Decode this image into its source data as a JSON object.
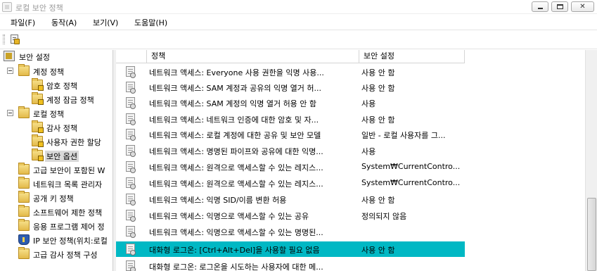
{
  "window": {
    "title": "로컬 보안 정책",
    "close_glyph": "✕"
  },
  "menu": [
    {
      "label": "파일(F)"
    },
    {
      "label": "동작(A)"
    },
    {
      "label": "보기(V)"
    },
    {
      "label": "도움말(H)"
    }
  ],
  "tree": {
    "root": "보안 설정",
    "account_policy": "계정 정책",
    "password_policy": "암호 정책",
    "account_lockout_policy": "계정 잠금 정책",
    "local_policy": "로컬 정책",
    "audit_policy": "감사 정책",
    "user_rights": "사용자 권한 할당",
    "security_options": "보안 옵션",
    "advanced_firewall": "고급 보안이 포함된 W",
    "network_list": "네트워크 목록 관리자",
    "public_key": "공개 키 정책",
    "software_restriction": "소프트웨어 제한 정책",
    "app_control": "응용 프로그램 제어 정",
    "ip_security": "IP 보안 정책(위치:로컬",
    "advanced_audit": "고급 감사 정책 구성"
  },
  "columns": {
    "policy": "정책",
    "security_setting": "보안 설정"
  },
  "rows": [
    {
      "policy": "네트워크 액세스: Everyone 사용 권한을 익명 사용...",
      "setting": "사용 안 함"
    },
    {
      "policy": "네트워크 액세스: SAM 계정과 공유의 익명 열거 허...",
      "setting": "사용 안 함"
    },
    {
      "policy": "네트워크 액세스: SAM 계정의 익명 열거 허용 안 함",
      "setting": "사용"
    },
    {
      "policy": "네트워크 액세스: 네트워크 인증에 대한 암호 및 자...",
      "setting": "사용 안 함"
    },
    {
      "policy": "네트워크 액세스: 로컬 계정에 대한 공유 및 보안 모델",
      "setting": "일반 - 로컬 사용자를 그..."
    },
    {
      "policy": "네트워크 액세스: 명명된 파이프와 공유에 대한 익명...",
      "setting": "사용"
    },
    {
      "policy": "네트워크 액세스: 원격으로 액세스할 수 있는 레지스...",
      "setting": "System₩CurrentContro..."
    },
    {
      "policy": "네트워크 액세스: 원격으로 액세스할 수 있는 레지스...",
      "setting": "System₩CurrentContro..."
    },
    {
      "policy": "네트워크 액세스: 익명 SID/이름 변환 허용",
      "setting": "사용 안 함"
    },
    {
      "policy": "네트워크 액세스: 익명으로 액세스할 수 있는 공유",
      "setting": "정의되지 않음"
    },
    {
      "policy": "네트워크 액세스: 익명으로 액세스할 수 있는 명명된...",
      "setting": ""
    },
    {
      "policy": "대화형 로그온: [Ctrl+Alt+Del]을 사용할 필요 없음",
      "setting": "사용 안 함"
    },
    {
      "policy": "대화형 로그온: 로그온을 시도하는 사용자에 대한 메...",
      "setting": ""
    }
  ],
  "colors": {
    "selection": "#00b8c4",
    "tree_selection": "#d9d9d9"
  }
}
